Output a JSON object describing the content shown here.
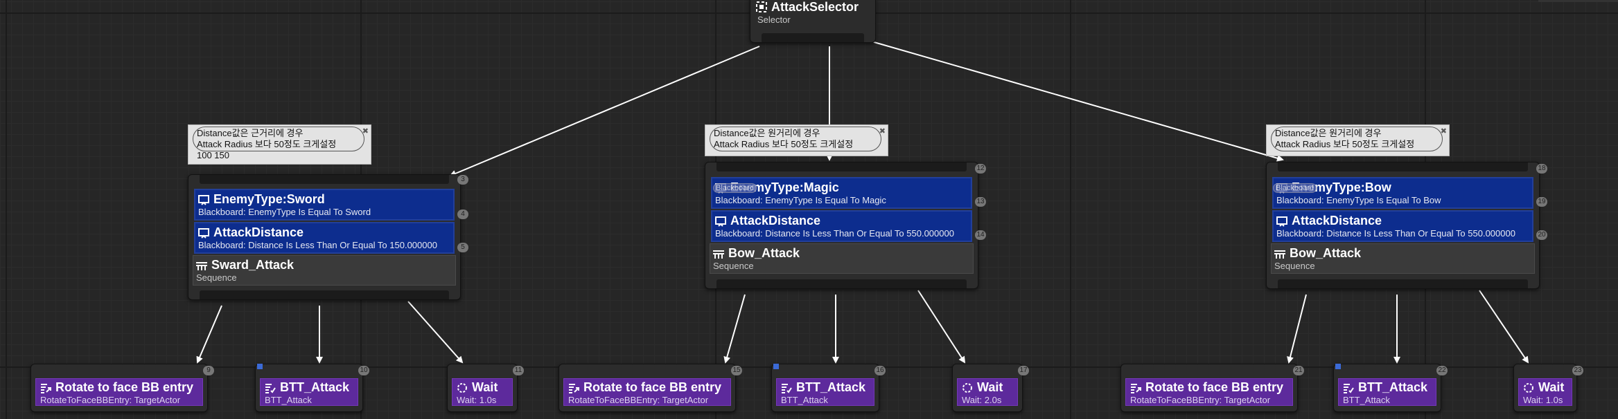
{
  "root": {
    "title": "AttackSelector",
    "subtitle": "Selector"
  },
  "comments": [
    {
      "line1": "Distance값은 근거리에 경우",
      "line2": "Attack Radius 보다 50정도 크게설정",
      "line3": "100 150"
    },
    {
      "line1": "Distance값은 원거리에 경우",
      "line2": "Attack Radius 보다 50정도 크게설정",
      "line3": ""
    },
    {
      "line1": "Distance값은 원거리에 경우",
      "line2": "Attack Radius 보다 50정도 크게설정",
      "line3": ""
    }
  ],
  "branches": [
    {
      "badge": "3",
      "decorators": [
        {
          "title": "EnemyType:Sword",
          "sub": "Blackboard: EnemyType Is Equal To Sword",
          "badge": "4"
        },
        {
          "title": "AttackDistance",
          "sub": "Blackboard: Distance Is Less Than Or Equal To 150.000000",
          "badge": "5"
        }
      ],
      "composite": {
        "title": "Sward_Attack",
        "sub": "Sequence"
      },
      "tasks": [
        {
          "title": "Rotate to face BB entry",
          "sub": "RotateToFaceBBEntry: TargetActor",
          "badge": "9"
        },
        {
          "title": "BTT_Attack",
          "sub": "BTT_Attack",
          "badge": "10"
        },
        {
          "title": "Wait",
          "sub": "Wait: 1.0s",
          "badge": "11"
        }
      ]
    },
    {
      "badge": "12",
      "decorators": [
        {
          "title": "EnemyType:Magic",
          "sub": "Blackboard: EnemyType Is Equal To Magic",
          "badge": "13"
        },
        {
          "title": "AttackDistance",
          "sub": "Blackboard: Distance Is Less Than Or Equal To 550.000000",
          "badge": "14"
        }
      ],
      "composite": {
        "title": "Bow_Attack",
        "sub": "Sequence"
      },
      "tasks": [
        {
          "title": "Rotate to face BB entry",
          "sub": "RotateToFaceBBEntry: TargetActor",
          "badge": "15"
        },
        {
          "title": "BTT_Attack",
          "sub": "BTT_Attack",
          "badge": "16"
        },
        {
          "title": "Wait",
          "sub": "Wait: 2.0s",
          "badge": "17"
        }
      ]
    },
    {
      "badge": "18",
      "decorators": [
        {
          "title": "EnemyType:Bow",
          "sub": "Blackboard: EnemyType Is Equal To Bow",
          "badge": "19"
        },
        {
          "title": "AttackDistance",
          "sub": "Blackboard: Distance Is Less Than Or Equal To 550.000000",
          "badge": "20"
        }
      ],
      "composite": {
        "title": "Bow_Attack",
        "sub": "Sequence"
      },
      "tasks": [
        {
          "title": "Rotate to face BB entry",
          "sub": "RotateToFaceBBEntry: TargetActor",
          "badge": "21"
        },
        {
          "title": "BTT_Attack",
          "sub": "BTT_Attack",
          "badge": "22"
        },
        {
          "title": "Wait",
          "sub": "Wait: 1.0s",
          "badge": "23"
        }
      ]
    }
  ],
  "ghost_label": "Blackboard",
  "colors": {
    "decorator": "#0d2d8e",
    "task": "#5d2a9c",
    "composite": "#3a3a3a",
    "wire": "#ffffff"
  }
}
